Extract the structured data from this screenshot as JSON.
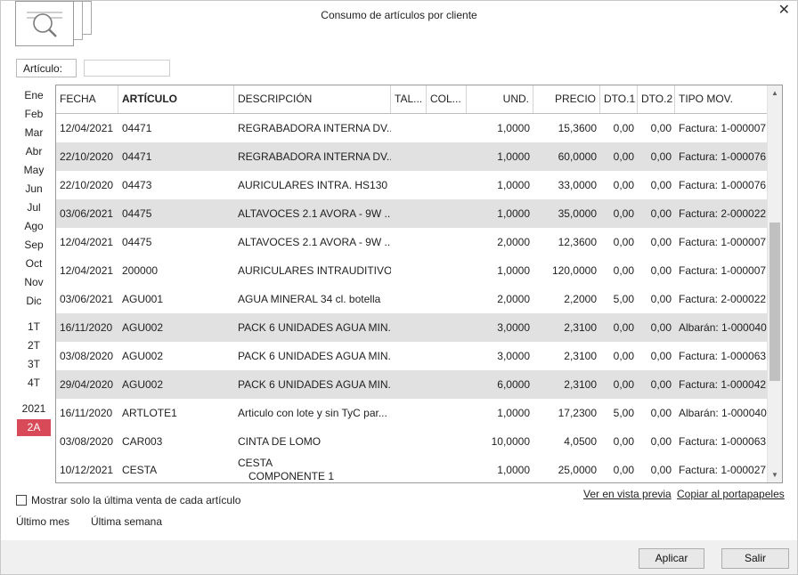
{
  "window": {
    "title": "Consumo de artículos por cliente",
    "close_glyph": "✕"
  },
  "filter": {
    "articulo_label": "Artículo:",
    "articulo_value": ""
  },
  "periods": {
    "months": [
      "Ene",
      "Feb",
      "Mar",
      "Abr",
      "May",
      "Jun",
      "Jul",
      "Ago",
      "Sep",
      "Oct",
      "Nov",
      "Dic"
    ],
    "quarters": [
      "1T",
      "2T",
      "3T",
      "4T"
    ],
    "years": [
      "2021",
      "2A"
    ],
    "selected": "2A"
  },
  "grid": {
    "columns": [
      "FECHA",
      "ARTÍCULO",
      "DESCRIPCIÓN",
      "TAL...",
      "COL...",
      "UND.",
      "PRECIO",
      "DTO.1",
      "DTO.2",
      "TIPO MOV."
    ],
    "rows": [
      {
        "fecha": "12/04/2021",
        "articulo": "04471",
        "descripcion": "REGRABADORA INTERNA  DV...",
        "descripcion2": "",
        "talla": "",
        "color": "",
        "und": "1,0000",
        "precio": "15,3600",
        "dto1": "0,00",
        "dto2": "0,00",
        "tipo": "Factura: 1-000007"
      },
      {
        "fecha": "22/10/2020",
        "articulo": "04471",
        "descripcion": "REGRABADORA INTERNA  DV...",
        "descripcion2": "",
        "talla": "",
        "color": "",
        "und": "1,0000",
        "precio": "60,0000",
        "dto1": "0,00",
        "dto2": "0,00",
        "tipo": "Factura: 1-000076"
      },
      {
        "fecha": "22/10/2020",
        "articulo": "04473",
        "descripcion": "AURICULARES INTRA.  HS130 ...",
        "descripcion2": "",
        "talla": "",
        "color": "",
        "und": "1,0000",
        "precio": "33,0000",
        "dto1": "0,00",
        "dto2": "0,00",
        "tipo": "Factura: 1-000076"
      },
      {
        "fecha": "03/06/2021",
        "articulo": "04475",
        "descripcion": "ALTAVOCES 2.1  AVORA - 9W ...",
        "descripcion2": "",
        "talla": "",
        "color": "",
        "und": "1,0000",
        "precio": "35,0000",
        "dto1": "0,00",
        "dto2": "0,00",
        "tipo": "Factura: 2-000022"
      },
      {
        "fecha": "12/04/2021",
        "articulo": "04475",
        "descripcion": "ALTAVOCES 2.1  AVORA - 9W ...",
        "descripcion2": "",
        "talla": "",
        "color": "",
        "und": "2,0000",
        "precio": "12,3600",
        "dto1": "0,00",
        "dto2": "0,00",
        "tipo": "Factura: 1-000007"
      },
      {
        "fecha": "12/04/2021",
        "articulo": "200000",
        "descripcion": "AURICULARES INTRAUDITIVO...",
        "descripcion2": "",
        "talla": "",
        "color": "",
        "und": "1,0000",
        "precio": "120,0000",
        "dto1": "0,00",
        "dto2": "0,00",
        "tipo": "Factura: 1-000007"
      },
      {
        "fecha": "03/06/2021",
        "articulo": "AGU001",
        "descripcion": "AGUA MINERAL 34 cl. botella",
        "descripcion2": "",
        "talla": "",
        "color": "",
        "und": "2,0000",
        "precio": "2,2000",
        "dto1": "5,00",
        "dto2": "0,00",
        "tipo": "Factura: 2-000022"
      },
      {
        "fecha": "16/11/2020",
        "articulo": "AGU002",
        "descripcion": "PACK 6 UNIDADES AGUA MIN...",
        "descripcion2": "",
        "talla": "",
        "color": "",
        "und": "3,0000",
        "precio": "2,3100",
        "dto1": "0,00",
        "dto2": "0,00",
        "tipo": "Albarán: 1-000040"
      },
      {
        "fecha": "03/08/2020",
        "articulo": "AGU002",
        "descripcion": "PACK 6 UNIDADES AGUA MIN...",
        "descripcion2": "",
        "talla": "",
        "color": "",
        "und": "3,0000",
        "precio": "2,3100",
        "dto1": "0,00",
        "dto2": "0,00",
        "tipo": "Factura: 1-000063"
      },
      {
        "fecha": "29/04/2020",
        "articulo": "AGU002",
        "descripcion": "PACK 6 UNIDADES AGUA MIN...",
        "descripcion2": "",
        "talla": "",
        "color": "",
        "und": "6,0000",
        "precio": "2,3100",
        "dto1": "0,00",
        "dto2": "0,00",
        "tipo": "Factura: 1-000042"
      },
      {
        "fecha": "16/11/2020",
        "articulo": "ARTLOTE1",
        "descripcion": "Articulo con lote y sin TyC par...",
        "descripcion2": "",
        "talla": "",
        "color": "",
        "und": "1,0000",
        "precio": "17,2300",
        "dto1": "5,00",
        "dto2": "0,00",
        "tipo": "Albarán: 1-000040"
      },
      {
        "fecha": "03/08/2020",
        "articulo": "CAR003",
        "descripcion": "CINTA DE LOMO",
        "descripcion2": "",
        "talla": "",
        "color": "",
        "und": "10,0000",
        "precio": "4,0500",
        "dto1": "0,00",
        "dto2": "0,00",
        "tipo": "Factura: 1-000063"
      },
      {
        "fecha": "10/12/2021",
        "articulo": "CESTA",
        "descripcion": "CESTA",
        "descripcion2": "COMPONENTE 1",
        "talla": "",
        "color": "",
        "und": "1,0000",
        "precio": "25,0000",
        "dto1": "0,00",
        "dto2": "0,00",
        "tipo": "Factura: 1-000027"
      }
    ],
    "scrollbar": {
      "up_glyph": "▲",
      "down_glyph": "▼"
    }
  },
  "options": {
    "last_sale_only_label": "Mostrar solo la última venta de cada artículo",
    "last_sale_only_checked": false
  },
  "links": {
    "preview": "Ver en vista previa",
    "clipboard": "Copiar al portapapeles",
    "last_month": "Último mes",
    "last_week": "Última semana"
  },
  "buttons": {
    "apply": "Aplicar",
    "exit": "Salir"
  },
  "colors": {
    "selected_period": "#d94a59",
    "alt_row": "#e1e1e1"
  }
}
